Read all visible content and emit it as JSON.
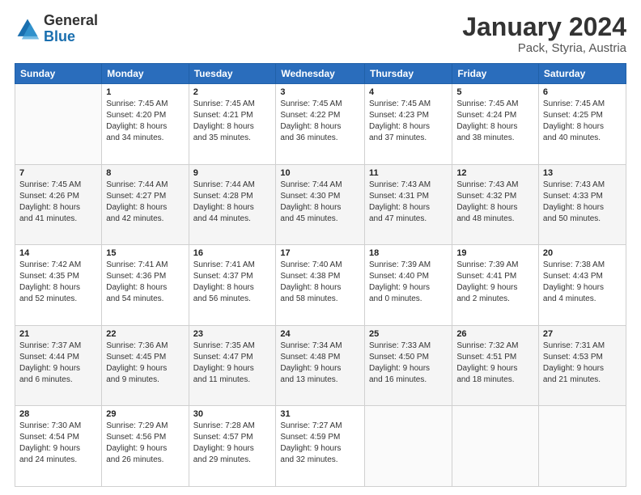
{
  "header": {
    "logo_line1": "General",
    "logo_line2": "Blue",
    "title": "January 2024",
    "subtitle": "Pack, Styria, Austria"
  },
  "days_of_week": [
    "Sunday",
    "Monday",
    "Tuesday",
    "Wednesday",
    "Thursday",
    "Friday",
    "Saturday"
  ],
  "weeks": [
    [
      {
        "day": "",
        "info": ""
      },
      {
        "day": "1",
        "info": "Sunrise: 7:45 AM\nSunset: 4:20 PM\nDaylight: 8 hours\nand 34 minutes."
      },
      {
        "day": "2",
        "info": "Sunrise: 7:45 AM\nSunset: 4:21 PM\nDaylight: 8 hours\nand 35 minutes."
      },
      {
        "day": "3",
        "info": "Sunrise: 7:45 AM\nSunset: 4:22 PM\nDaylight: 8 hours\nand 36 minutes."
      },
      {
        "day": "4",
        "info": "Sunrise: 7:45 AM\nSunset: 4:23 PM\nDaylight: 8 hours\nand 37 minutes."
      },
      {
        "day": "5",
        "info": "Sunrise: 7:45 AM\nSunset: 4:24 PM\nDaylight: 8 hours\nand 38 minutes."
      },
      {
        "day": "6",
        "info": "Sunrise: 7:45 AM\nSunset: 4:25 PM\nDaylight: 8 hours\nand 40 minutes."
      }
    ],
    [
      {
        "day": "7",
        "info": "Sunrise: 7:45 AM\nSunset: 4:26 PM\nDaylight: 8 hours\nand 41 minutes."
      },
      {
        "day": "8",
        "info": "Sunrise: 7:44 AM\nSunset: 4:27 PM\nDaylight: 8 hours\nand 42 minutes."
      },
      {
        "day": "9",
        "info": "Sunrise: 7:44 AM\nSunset: 4:28 PM\nDaylight: 8 hours\nand 44 minutes."
      },
      {
        "day": "10",
        "info": "Sunrise: 7:44 AM\nSunset: 4:30 PM\nDaylight: 8 hours\nand 45 minutes."
      },
      {
        "day": "11",
        "info": "Sunrise: 7:43 AM\nSunset: 4:31 PM\nDaylight: 8 hours\nand 47 minutes."
      },
      {
        "day": "12",
        "info": "Sunrise: 7:43 AM\nSunset: 4:32 PM\nDaylight: 8 hours\nand 48 minutes."
      },
      {
        "day": "13",
        "info": "Sunrise: 7:43 AM\nSunset: 4:33 PM\nDaylight: 8 hours\nand 50 minutes."
      }
    ],
    [
      {
        "day": "14",
        "info": "Sunrise: 7:42 AM\nSunset: 4:35 PM\nDaylight: 8 hours\nand 52 minutes."
      },
      {
        "day": "15",
        "info": "Sunrise: 7:41 AM\nSunset: 4:36 PM\nDaylight: 8 hours\nand 54 minutes."
      },
      {
        "day": "16",
        "info": "Sunrise: 7:41 AM\nSunset: 4:37 PM\nDaylight: 8 hours\nand 56 minutes."
      },
      {
        "day": "17",
        "info": "Sunrise: 7:40 AM\nSunset: 4:38 PM\nDaylight: 8 hours\nand 58 minutes."
      },
      {
        "day": "18",
        "info": "Sunrise: 7:39 AM\nSunset: 4:40 PM\nDaylight: 9 hours\nand 0 minutes."
      },
      {
        "day": "19",
        "info": "Sunrise: 7:39 AM\nSunset: 4:41 PM\nDaylight: 9 hours\nand 2 minutes."
      },
      {
        "day": "20",
        "info": "Sunrise: 7:38 AM\nSunset: 4:43 PM\nDaylight: 9 hours\nand 4 minutes."
      }
    ],
    [
      {
        "day": "21",
        "info": "Sunrise: 7:37 AM\nSunset: 4:44 PM\nDaylight: 9 hours\nand 6 minutes."
      },
      {
        "day": "22",
        "info": "Sunrise: 7:36 AM\nSunset: 4:45 PM\nDaylight: 9 hours\nand 9 minutes."
      },
      {
        "day": "23",
        "info": "Sunrise: 7:35 AM\nSunset: 4:47 PM\nDaylight: 9 hours\nand 11 minutes."
      },
      {
        "day": "24",
        "info": "Sunrise: 7:34 AM\nSunset: 4:48 PM\nDaylight: 9 hours\nand 13 minutes."
      },
      {
        "day": "25",
        "info": "Sunrise: 7:33 AM\nSunset: 4:50 PM\nDaylight: 9 hours\nand 16 minutes."
      },
      {
        "day": "26",
        "info": "Sunrise: 7:32 AM\nSunset: 4:51 PM\nDaylight: 9 hours\nand 18 minutes."
      },
      {
        "day": "27",
        "info": "Sunrise: 7:31 AM\nSunset: 4:53 PM\nDaylight: 9 hours\nand 21 minutes."
      }
    ],
    [
      {
        "day": "28",
        "info": "Sunrise: 7:30 AM\nSunset: 4:54 PM\nDaylight: 9 hours\nand 24 minutes."
      },
      {
        "day": "29",
        "info": "Sunrise: 7:29 AM\nSunset: 4:56 PM\nDaylight: 9 hours\nand 26 minutes."
      },
      {
        "day": "30",
        "info": "Sunrise: 7:28 AM\nSunset: 4:57 PM\nDaylight: 9 hours\nand 29 minutes."
      },
      {
        "day": "31",
        "info": "Sunrise: 7:27 AM\nSunset: 4:59 PM\nDaylight: 9 hours\nand 32 minutes."
      },
      {
        "day": "",
        "info": ""
      },
      {
        "day": "",
        "info": ""
      },
      {
        "day": "",
        "info": ""
      }
    ]
  ]
}
